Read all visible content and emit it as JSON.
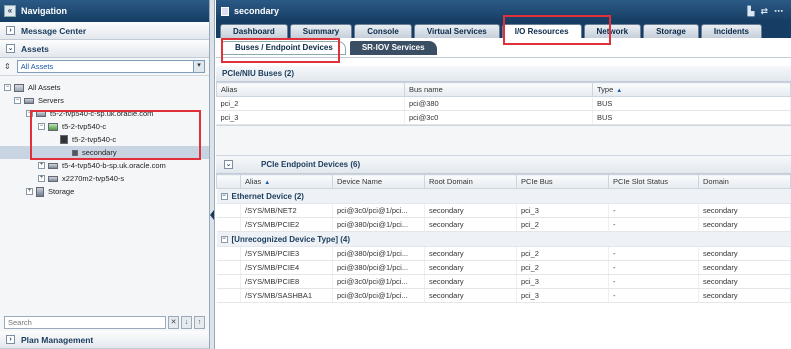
{
  "navigation": {
    "title": "Navigation",
    "collapse_icon": "«",
    "message_center": "Message Center",
    "assets": "Assets",
    "filter_value": "All Assets",
    "tree": {
      "root": "All Assets",
      "servers": "Servers",
      "server1": "t5-2-tvp540-c-sp.uk.oracle.com",
      "server1_child": "t5-2-tvp540-c",
      "server1_grandchild": "t5-2-tvp540-c",
      "ldom": "secondary",
      "server2": "t5-4-tvp540-b-sp.uk.oracle.com",
      "server3": "x2270m2-tvp540-s",
      "storage": "Storage"
    },
    "search_placeholder": "Search",
    "plan_management": "Plan Management"
  },
  "main": {
    "title": "secondary",
    "tabs": [
      "Dashboard",
      "Summary",
      "Console",
      "Virtual Services",
      "I/O Resources",
      "Network",
      "Storage",
      "Incidents"
    ],
    "active_tab": "I/O Resources",
    "subtabs": [
      "Buses / Endpoint Devices",
      "SR-IOV Services"
    ],
    "buses": {
      "title": "PCIe/NIU Buses (2)",
      "columns": [
        "Alias",
        "Bus name",
        "Type"
      ],
      "rows": [
        [
          "pci_2",
          "pci@380",
          "BUS"
        ],
        [
          "pci_3",
          "pci@3c0",
          "BUS"
        ]
      ]
    },
    "endpoints": {
      "title": "PCIe Endpoint Devices (6)",
      "columns": [
        "Alias",
        "Device Name",
        "Root Domain",
        "PCIe Bus",
        "PCIe Slot Status",
        "Domain"
      ],
      "group1": "Ethernet Device (2)",
      "group1_rows": [
        [
          "/SYS/MB/NET2",
          "pci@3c0/pci@1/pci...",
          "secondary",
          "pci_3",
          "-",
          "secondary"
        ],
        [
          "/SYS/MB/PCIE2",
          "pci@380/pci@1/pci...",
          "secondary",
          "pci_2",
          "-",
          "secondary"
        ]
      ],
      "group2": "[Unrecognized Device Type] (4)",
      "group2_rows": [
        [
          "/SYS/MB/PCIE3",
          "pci@380/pci@1/pci...",
          "secondary",
          "pci_2",
          "-",
          "secondary"
        ],
        [
          "/SYS/MB/PCIE4",
          "pci@380/pci@1/pci...",
          "secondary",
          "pci_2",
          "-",
          "secondary"
        ],
        [
          "/SYS/MB/PCIE8",
          "pci@3c0/pci@1/pci...",
          "secondary",
          "pci_3",
          "-",
          "secondary"
        ],
        [
          "/SYS/MB/SASHBA1",
          "pci@3c0/pci@1/pci...",
          "secondary",
          "pci_3",
          "-",
          "secondary"
        ]
      ]
    }
  },
  "colors": {
    "header": "#163d63",
    "highlight": "#e0303a",
    "selection": "#c8d4e2"
  }
}
